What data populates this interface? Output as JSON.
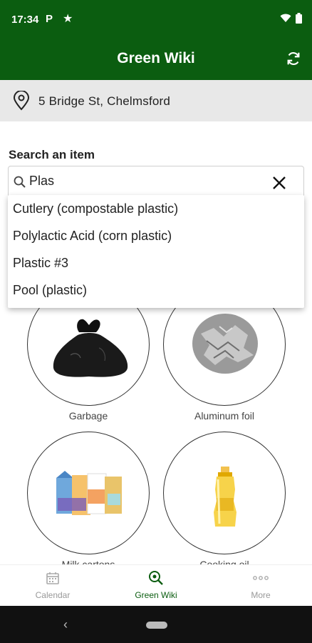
{
  "status_bar": {
    "time": "17:34",
    "p_label": "P"
  },
  "app_bar": {
    "title": "Green Wiki"
  },
  "location": {
    "address": "5 Bridge St, Chelmsford"
  },
  "search": {
    "label": "Search an item",
    "value": "Plas",
    "suggestions": [
      "Cutlery (compostable plastic)",
      "Polylactic Acid (corn plastic)",
      "Plastic #3",
      "Pool (plastic)"
    ]
  },
  "items": [
    {
      "label": "Garbage",
      "icon": "garbage-bag-icon"
    },
    {
      "label": "Aluminum foil",
      "icon": "aluminum-foil-icon"
    },
    {
      "label": "Milk cartons",
      "icon": "milk-cartons-icon"
    },
    {
      "label": "Cooking oil",
      "icon": "cooking-oil-icon"
    }
  ],
  "bottom_nav": {
    "items": [
      {
        "label": "Calendar",
        "active": false
      },
      {
        "label": "Green Wiki",
        "active": true
      },
      {
        "label": "More",
        "active": false
      }
    ]
  },
  "colors": {
    "primary": "#0b5d10",
    "location_bg": "#e8e8e8",
    "inactive": "#999999"
  }
}
